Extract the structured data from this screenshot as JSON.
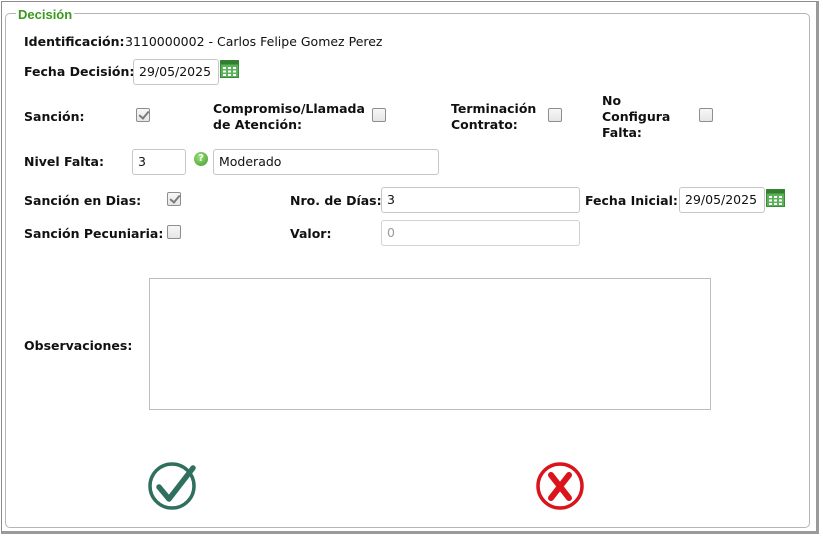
{
  "legend": "Decisión",
  "identificacion": {
    "label": "Identificación:",
    "value": "3110000002 - Carlos Felipe Gomez Perez"
  },
  "fecha_decision": {
    "label": "Fecha Decisión:",
    "value": "29/05/2025"
  },
  "sancion": {
    "label": "Sanción:",
    "checked": true
  },
  "compromiso": {
    "label_line1": "Compromiso/Llamada",
    "label_line2": "de Atención:",
    "checked": false
  },
  "terminacion": {
    "label_line1": "Terminación",
    "label_line2": "Contrato:",
    "checked": false
  },
  "no_configura": {
    "label_line1": "No",
    "label_line2": "Configura",
    "label_line3": "Falta:",
    "checked": false
  },
  "nivel_falta": {
    "label": "Nivel Falta:",
    "code": "3",
    "description": "Moderado"
  },
  "sancion_dias": {
    "label": "Sanción en Dias:",
    "checked": true
  },
  "nro_dias": {
    "label": "Nro. de Días:",
    "value": "3"
  },
  "fecha_inicial": {
    "label": "Fecha Inicial:",
    "value": "29/05/2025"
  },
  "sancion_pecuniaria": {
    "label": "Sanción Pecuniaria:",
    "checked": false
  },
  "valor": {
    "label": "Valor:",
    "value": "0"
  },
  "observaciones": {
    "label": "Observaciones:",
    "value": ""
  },
  "icons": {
    "calendar": "calendar-icon",
    "help": "help-icon",
    "accept": "accept-check-icon",
    "cancel": "cancel-x-icon"
  },
  "colors": {
    "legend": "#3a9a1f",
    "accept": "#2f6f5e",
    "cancel": "#d9141c"
  }
}
